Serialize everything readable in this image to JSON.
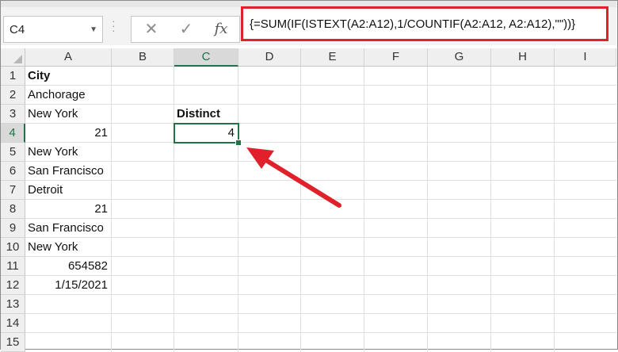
{
  "name_box": {
    "value": "C4"
  },
  "formula_bar": {
    "cancel_icon": "close-icon",
    "enter_icon": "check-icon",
    "function_label": "fx",
    "formula": "{=SUM(IF(ISTEXT(A2:A12),1/COUNTIF(A2:A12, A2:A12),\"\"))}"
  },
  "columns": [
    "A",
    "B",
    "C",
    "D",
    "E",
    "F",
    "G",
    "H",
    "I"
  ],
  "rows": [
    "1",
    "2",
    "3",
    "4",
    "5",
    "6",
    "7",
    "8",
    "9",
    "10",
    "11",
    "12",
    "13",
    "14",
    "15"
  ],
  "selected_cell": {
    "column": "C",
    "row": "4"
  },
  "cells": {
    "A1": "City",
    "A2": "Anchorage",
    "A3": "New York",
    "A4": "21",
    "A5": "New York",
    "A6": "San Francisco",
    "A7": "Detroit",
    "A8": "21",
    "A9": "San Francisco",
    "A10": "New York",
    "A11": "654582",
    "A12": "1/15/2021",
    "C3": "Distinct",
    "C4": "4"
  },
  "colors": {
    "highlight": "#e0212b",
    "selection": "#217346"
  }
}
